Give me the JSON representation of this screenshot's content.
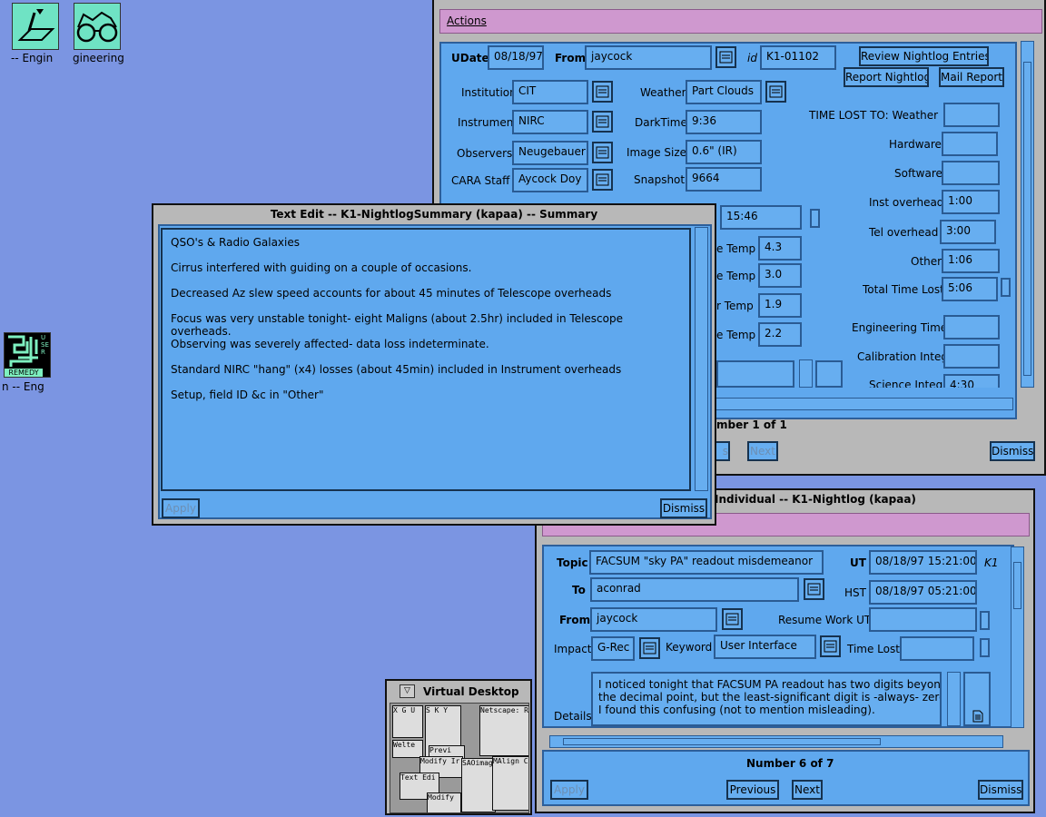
{
  "desktop": {
    "icons": [
      {
        "label": "-- Engin"
      },
      {
        "label": "gineering"
      },
      {
        "label": "n -- Eng",
        "badge": "REMEDY",
        "side": "USER"
      }
    ]
  },
  "actions_win": {
    "menu": "Actions",
    "udate_label": "UDate",
    "udate": "08/18/97",
    "from_label": "From",
    "from": "jaycock",
    "id_label": "id",
    "id": "K1-01102",
    "review_btn": "Review Nightlog Entries",
    "report_btn": "Report Nightlog",
    "mail_btn": "Mail Report",
    "institution_label": "Institution",
    "institution": "CIT",
    "instrument_label": "Instrument",
    "instrument": "NIRC",
    "observers_label": "Observers",
    "observers": "Neugebauer",
    "staff_label": "CARA Staff",
    "staff": "Aycock Doy",
    "weather_label": "Weather",
    "weather": "Part Clouds",
    "darktime_label": "DarkTime",
    "darktime": "9:36",
    "imagesize_label": "Image Size",
    "imagesize": "0.6\" (IR)",
    "snapshot_label": "Snapshot",
    "snapshot": "9664",
    "time_value": "15:46",
    "temps": [
      {
        "label": "e Temp",
        "value": "4.3"
      },
      {
        "label": "e Temp",
        "value": "3.0"
      },
      {
        "label": "r Temp",
        "value": "1.9"
      },
      {
        "label": "e Temp",
        "value": "2.2"
      }
    ],
    "time_lost_label": "TIME LOST TO:  Weather",
    "weather_lost": "",
    "hardware_label": "Hardware",
    "hardware": "",
    "software_label": "Software",
    "software": "",
    "inst_label": "Inst overhead",
    "inst": "1:00",
    "tel_label": "Tel overhead",
    "tel": "3:00",
    "other_label": "Other",
    "other": "1:06",
    "total_label": "Total Time Lost",
    "total": "5:06",
    "eng_label": "Engineering Time",
    "eng": "",
    "cal_label": "Calibration Integ",
    "cal": "",
    "sci_label": "Science Integ",
    "sci": "4:30",
    "number": "mber 1 of 1",
    "prev": "s",
    "next": "Next",
    "dismiss": "Dismiss"
  },
  "text_edit": {
    "title": "Text Edit -- K1-NightlogSummary (kapaa) -- Summary",
    "paragraphs": [
      "QSO's & Radio Galaxies",
      "Cirrus interfered with guiding on a couple of occasions.",
      "Decreased Az slew speed accounts for about 45 minutes of Telescope overheads",
      "Focus was very unstable tonight- eight Maligns (about 2.5hr) included in Telescope overheads.\nObserving was severely affected- data loss indeterminate.",
      "Standard NIRC \"hang\" (x4) losses (about 45min) included in Instrument overheads",
      "Setup, field ID &c in \"Other\""
    ],
    "apply": "Apply",
    "dismiss": "Dismiss"
  },
  "individual": {
    "title": "Individual -- K1-Nightlog (kapaa)",
    "topic_label": "Topic",
    "topic": "FACSUM \"sky PA\"  readout misdemeanor",
    "ut_label": "UT",
    "ut": "08/18/97 15:21:00",
    "ut_extra": "K1",
    "to_label": "To",
    "to": "aconrad",
    "hst_label": "HST",
    "hst": "08/18/97 05:21:00",
    "from_label": "From",
    "from": "jaycock",
    "resume_label": "Resume Work UT",
    "resume": "",
    "impact_label": "Impact",
    "impact": "G-Rec",
    "keyword_label": "Keyword",
    "keyword": "User Interface",
    "timelost_label": "Time Lost",
    "timelost": "",
    "details_label": "Details",
    "details": "I noticed tonight that FACSUM PA readout has two digits beyond\nthe decimal point, but the least-significant digit is -always- zero.\nI found this confusing (not to mention misleading).",
    "number": "Number 6 of 7",
    "apply": "Apply",
    "previous": "Previous",
    "next": "Next",
    "dismiss": "Dismiss"
  },
  "vdesk": {
    "title": "Virtual Desktop",
    "labels": [
      "X G U",
      "S K Y",
      "Netscape: R",
      "Welte",
      "Previ",
      "Modify Ir",
      "SAOimag",
      "MAlign C",
      "Text Edi",
      "Modify"
    ]
  }
}
